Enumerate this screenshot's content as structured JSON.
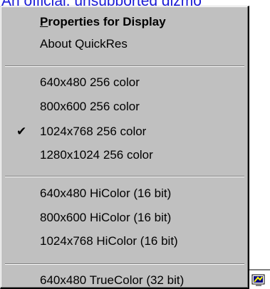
{
  "background_link": {
    "text": "An official, unsupported gizmo"
  },
  "menu": {
    "items": [
      {
        "label_rest": "roperties for Display",
        "label_accel": "P"
      },
      {
        "label": "About QuickRes"
      },
      {
        "label": "640x480 256 color"
      },
      {
        "label": "800x600 256 color"
      },
      {
        "label": "1024x768 256 color",
        "checked": true
      },
      {
        "label": "1280x1024 256 color"
      },
      {
        "label": "640x480 HiColor (16 bit)"
      },
      {
        "label": "800x600 HiColor (16 bit)"
      },
      {
        "label": "1024x768 HiColor (16 bit)"
      },
      {
        "label": "640x480 TrueColor (32 bit)"
      }
    ],
    "check_glyph": "✔"
  },
  "tray": {
    "icon": "display-settings-icon"
  },
  "colors": {
    "menu_face": "#c0c0c0",
    "link": "#1a1ad6"
  }
}
